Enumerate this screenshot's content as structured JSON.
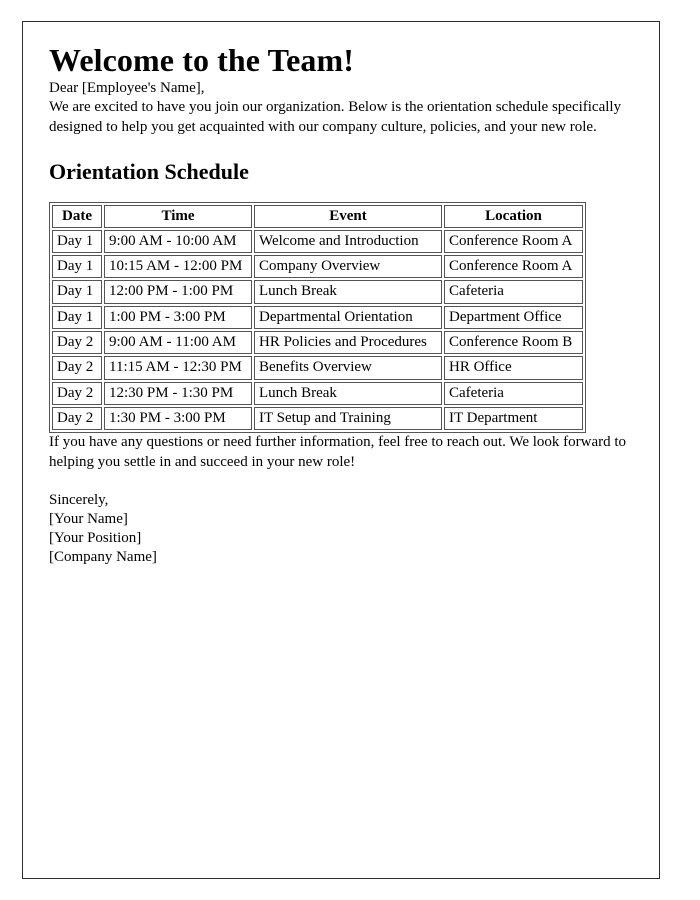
{
  "document": {
    "title": "Welcome to the Team!",
    "salutation": "Dear [Employee's Name],",
    "intro_paragraph": "We are excited to have you join our organization. Below is the orientation schedule specifically designed to help you get acquainted with our company culture, policies, and your new role.",
    "section_heading": "Orientation Schedule",
    "closing_paragraph": "If you have any questions or need further information, feel free to reach out. We look forward to helping you settle in and succeed in your new role!",
    "signature": {
      "sign_off": "Sincerely,",
      "name": "[Your Name]",
      "position": "[Your Position]",
      "company": "[Company Name]"
    }
  },
  "schedule_table": {
    "headers": [
      "Date",
      "Time",
      "Event",
      "Location"
    ],
    "rows": [
      {
        "date": "Day 1",
        "time": "9:00 AM - 10:00 AM",
        "event": "Welcome and Introduction",
        "location": "Conference Room A"
      },
      {
        "date": "Day 1",
        "time": "10:15 AM - 12:00 PM",
        "event": "Company Overview",
        "location": "Conference Room A"
      },
      {
        "date": "Day 1",
        "time": "12:00 PM - 1:00 PM",
        "event": "Lunch Break",
        "location": "Cafeteria"
      },
      {
        "date": "Day 1",
        "time": "1:00 PM - 3:00 PM",
        "event": "Departmental Orientation",
        "location": "Department Office"
      },
      {
        "date": "Day 2",
        "time": "9:00 AM - 11:00 AM",
        "event": "HR Policies and Procedures",
        "location": "Conference Room B"
      },
      {
        "date": "Day 2",
        "time": "11:15 AM - 12:30 PM",
        "event": "Benefits Overview",
        "location": "HR Office"
      },
      {
        "date": "Day 2",
        "time": "12:30 PM - 1:30 PM",
        "event": "Lunch Break",
        "location": "Cafeteria"
      },
      {
        "date": "Day 2",
        "time": "1:30 PM - 3:00 PM",
        "event": "IT Setup and Training",
        "location": "IT Department"
      }
    ]
  },
  "style": {
    "page_border_color": "#2b2b2b",
    "table_border_color": "#555555",
    "text_color": "#000000",
    "background_color": "#ffffff"
  }
}
